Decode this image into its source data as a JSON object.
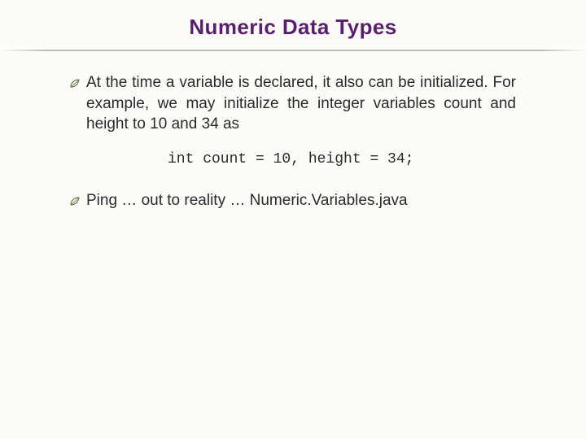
{
  "title": "Numeric Data Types",
  "bullets": [
    {
      "text": "At the time a variable is declared, it also can be initialized. For example, we may initialize the integer variables count and height to 10 and 34 as",
      "justify": true
    },
    {
      "text": "Ping … out to reality … Numeric.Variables.java",
      "justify": false
    }
  ],
  "code": "int count = 10, height = 34;"
}
